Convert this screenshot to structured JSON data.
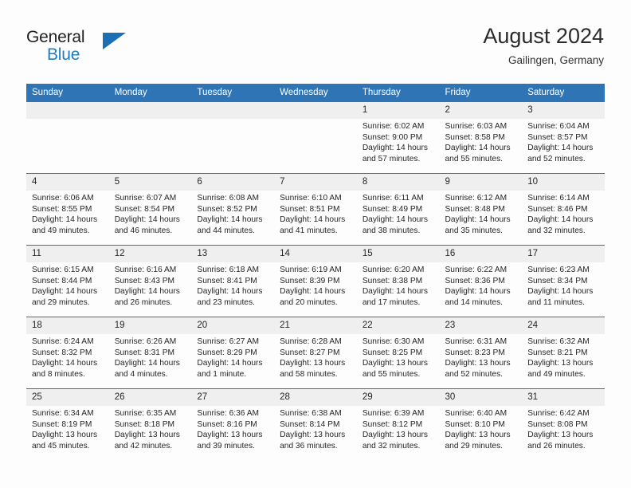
{
  "brand": {
    "line1": "General",
    "line2": "Blue",
    "triangle_color": "#1a6fb5",
    "blue_text_color": "#1d7dc6"
  },
  "header": {
    "title": "August 2024",
    "subtitle": "Gailingen, Germany"
  },
  "theme": {
    "header_blue": "#2f75b5",
    "daynum_band": "#efefef",
    "row_separator": "#2f75b5",
    "page_background": "#fdfdfd",
    "text": "#262626"
  },
  "weekday_headers": [
    "Sunday",
    "Monday",
    "Tuesday",
    "Wednesday",
    "Thursday",
    "Friday",
    "Saturday"
  ],
  "labels": {
    "sunrise_prefix": "Sunrise:",
    "sunset_prefix": "Sunset:",
    "daylight_prefix": "Daylight:"
  },
  "weeks": [
    [
      {
        "day": "",
        "empty": true,
        "sunrise": "",
        "sunset": "",
        "daylight_line1": "",
        "daylight_line2": ""
      },
      {
        "day": "",
        "empty": true,
        "sunrise": "",
        "sunset": "",
        "daylight_line1": "",
        "daylight_line2": ""
      },
      {
        "day": "",
        "empty": true,
        "sunrise": "",
        "sunset": "",
        "daylight_line1": "",
        "daylight_line2": ""
      },
      {
        "day": "",
        "empty": true,
        "sunrise": "",
        "sunset": "",
        "daylight_line1": "",
        "daylight_line2": ""
      },
      {
        "day": "1",
        "empty": false,
        "sunrise": "Sunrise: 6:02 AM",
        "sunset": "Sunset: 9:00 PM",
        "daylight_line1": "Daylight: 14 hours",
        "daylight_line2": "and 57 minutes."
      },
      {
        "day": "2",
        "empty": false,
        "sunrise": "Sunrise: 6:03 AM",
        "sunset": "Sunset: 8:58 PM",
        "daylight_line1": "Daylight: 14 hours",
        "daylight_line2": "and 55 minutes."
      },
      {
        "day": "3",
        "empty": false,
        "sunrise": "Sunrise: 6:04 AM",
        "sunset": "Sunset: 8:57 PM",
        "daylight_line1": "Daylight: 14 hours",
        "daylight_line2": "and 52 minutes."
      }
    ],
    [
      {
        "day": "4",
        "empty": false,
        "sunrise": "Sunrise: 6:06 AM",
        "sunset": "Sunset: 8:55 PM",
        "daylight_line1": "Daylight: 14 hours",
        "daylight_line2": "and 49 minutes."
      },
      {
        "day": "5",
        "empty": false,
        "sunrise": "Sunrise: 6:07 AM",
        "sunset": "Sunset: 8:54 PM",
        "daylight_line1": "Daylight: 14 hours",
        "daylight_line2": "and 46 minutes."
      },
      {
        "day": "6",
        "empty": false,
        "sunrise": "Sunrise: 6:08 AM",
        "sunset": "Sunset: 8:52 PM",
        "daylight_line1": "Daylight: 14 hours",
        "daylight_line2": "and 44 minutes."
      },
      {
        "day": "7",
        "empty": false,
        "sunrise": "Sunrise: 6:10 AM",
        "sunset": "Sunset: 8:51 PM",
        "daylight_line1": "Daylight: 14 hours",
        "daylight_line2": "and 41 minutes."
      },
      {
        "day": "8",
        "empty": false,
        "sunrise": "Sunrise: 6:11 AM",
        "sunset": "Sunset: 8:49 PM",
        "daylight_line1": "Daylight: 14 hours",
        "daylight_line2": "and 38 minutes."
      },
      {
        "day": "9",
        "empty": false,
        "sunrise": "Sunrise: 6:12 AM",
        "sunset": "Sunset: 8:48 PM",
        "daylight_line1": "Daylight: 14 hours",
        "daylight_line2": "and 35 minutes."
      },
      {
        "day": "10",
        "empty": false,
        "sunrise": "Sunrise: 6:14 AM",
        "sunset": "Sunset: 8:46 PM",
        "daylight_line1": "Daylight: 14 hours",
        "daylight_line2": "and 32 minutes."
      }
    ],
    [
      {
        "day": "11",
        "empty": false,
        "sunrise": "Sunrise: 6:15 AM",
        "sunset": "Sunset: 8:44 PM",
        "daylight_line1": "Daylight: 14 hours",
        "daylight_line2": "and 29 minutes."
      },
      {
        "day": "12",
        "empty": false,
        "sunrise": "Sunrise: 6:16 AM",
        "sunset": "Sunset: 8:43 PM",
        "daylight_line1": "Daylight: 14 hours",
        "daylight_line2": "and 26 minutes."
      },
      {
        "day": "13",
        "empty": false,
        "sunrise": "Sunrise: 6:18 AM",
        "sunset": "Sunset: 8:41 PM",
        "daylight_line1": "Daylight: 14 hours",
        "daylight_line2": "and 23 minutes."
      },
      {
        "day": "14",
        "empty": false,
        "sunrise": "Sunrise: 6:19 AM",
        "sunset": "Sunset: 8:39 PM",
        "daylight_line1": "Daylight: 14 hours",
        "daylight_line2": "and 20 minutes."
      },
      {
        "day": "15",
        "empty": false,
        "sunrise": "Sunrise: 6:20 AM",
        "sunset": "Sunset: 8:38 PM",
        "daylight_line1": "Daylight: 14 hours",
        "daylight_line2": "and 17 minutes."
      },
      {
        "day": "16",
        "empty": false,
        "sunrise": "Sunrise: 6:22 AM",
        "sunset": "Sunset: 8:36 PM",
        "daylight_line1": "Daylight: 14 hours",
        "daylight_line2": "and 14 minutes."
      },
      {
        "day": "17",
        "empty": false,
        "sunrise": "Sunrise: 6:23 AM",
        "sunset": "Sunset: 8:34 PM",
        "daylight_line1": "Daylight: 14 hours",
        "daylight_line2": "and 11 minutes."
      }
    ],
    [
      {
        "day": "18",
        "empty": false,
        "sunrise": "Sunrise: 6:24 AM",
        "sunset": "Sunset: 8:32 PM",
        "daylight_line1": "Daylight: 14 hours",
        "daylight_line2": "and 8 minutes."
      },
      {
        "day": "19",
        "empty": false,
        "sunrise": "Sunrise: 6:26 AM",
        "sunset": "Sunset: 8:31 PM",
        "daylight_line1": "Daylight: 14 hours",
        "daylight_line2": "and 4 minutes."
      },
      {
        "day": "20",
        "empty": false,
        "sunrise": "Sunrise: 6:27 AM",
        "sunset": "Sunset: 8:29 PM",
        "daylight_line1": "Daylight: 14 hours",
        "daylight_line2": "and 1 minute."
      },
      {
        "day": "21",
        "empty": false,
        "sunrise": "Sunrise: 6:28 AM",
        "sunset": "Sunset: 8:27 PM",
        "daylight_line1": "Daylight: 13 hours",
        "daylight_line2": "and 58 minutes."
      },
      {
        "day": "22",
        "empty": false,
        "sunrise": "Sunrise: 6:30 AM",
        "sunset": "Sunset: 8:25 PM",
        "daylight_line1": "Daylight: 13 hours",
        "daylight_line2": "and 55 minutes."
      },
      {
        "day": "23",
        "empty": false,
        "sunrise": "Sunrise: 6:31 AM",
        "sunset": "Sunset: 8:23 PM",
        "daylight_line1": "Daylight: 13 hours",
        "daylight_line2": "and 52 minutes."
      },
      {
        "day": "24",
        "empty": false,
        "sunrise": "Sunrise: 6:32 AM",
        "sunset": "Sunset: 8:21 PM",
        "daylight_line1": "Daylight: 13 hours",
        "daylight_line2": "and 49 minutes."
      }
    ],
    [
      {
        "day": "25",
        "empty": false,
        "sunrise": "Sunrise: 6:34 AM",
        "sunset": "Sunset: 8:19 PM",
        "daylight_line1": "Daylight: 13 hours",
        "daylight_line2": "and 45 minutes."
      },
      {
        "day": "26",
        "empty": false,
        "sunrise": "Sunrise: 6:35 AM",
        "sunset": "Sunset: 8:18 PM",
        "daylight_line1": "Daylight: 13 hours",
        "daylight_line2": "and 42 minutes."
      },
      {
        "day": "27",
        "empty": false,
        "sunrise": "Sunrise: 6:36 AM",
        "sunset": "Sunset: 8:16 PM",
        "daylight_line1": "Daylight: 13 hours",
        "daylight_line2": "and 39 minutes."
      },
      {
        "day": "28",
        "empty": false,
        "sunrise": "Sunrise: 6:38 AM",
        "sunset": "Sunset: 8:14 PM",
        "daylight_line1": "Daylight: 13 hours",
        "daylight_line2": "and 36 minutes."
      },
      {
        "day": "29",
        "empty": false,
        "sunrise": "Sunrise: 6:39 AM",
        "sunset": "Sunset: 8:12 PM",
        "daylight_line1": "Daylight: 13 hours",
        "daylight_line2": "and 32 minutes."
      },
      {
        "day": "30",
        "empty": false,
        "sunrise": "Sunrise: 6:40 AM",
        "sunset": "Sunset: 8:10 PM",
        "daylight_line1": "Daylight: 13 hours",
        "daylight_line2": "and 29 minutes."
      },
      {
        "day": "31",
        "empty": false,
        "sunrise": "Sunrise: 6:42 AM",
        "sunset": "Sunset: 8:08 PM",
        "daylight_line1": "Daylight: 13 hours",
        "daylight_line2": "and 26 minutes."
      }
    ]
  ]
}
